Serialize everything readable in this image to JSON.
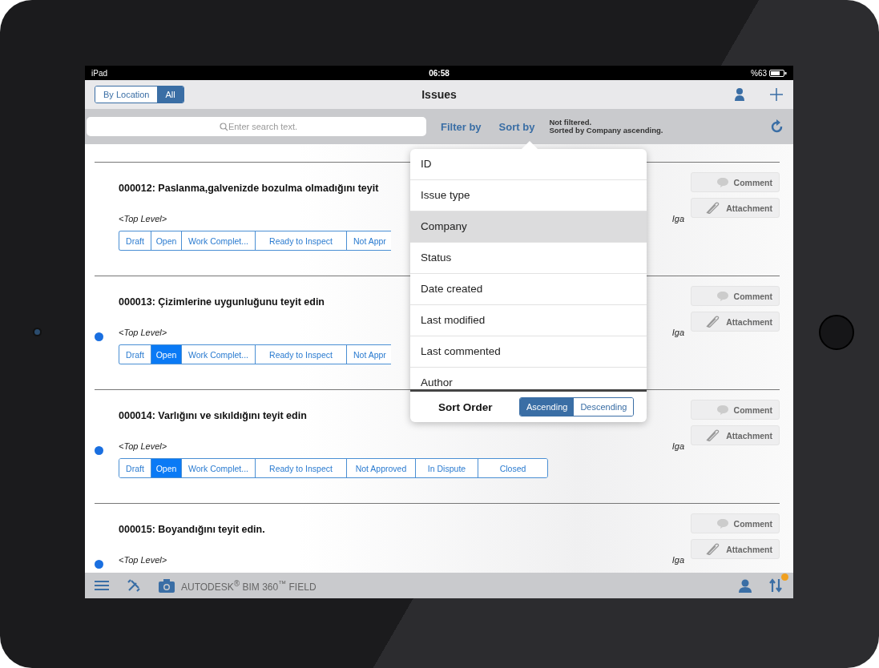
{
  "status_bar": {
    "device": "iPad",
    "time": "06:58",
    "battery": "%63"
  },
  "nav": {
    "segments": [
      {
        "label": "By Location",
        "selected": false
      },
      {
        "label": "All",
        "selected": true
      }
    ],
    "title": "Issues"
  },
  "search": {
    "placeholder": "Enter search text."
  },
  "filter_button": "Filter by",
  "sort_button": "Sort by",
  "filter_status": [
    "Not filtered.",
    "Sorted by Company ascending."
  ],
  "issues": [
    {
      "title": "000012: Paslanma,galvenizde bozulma olmadığını teyit",
      "unread": false,
      "location": "<Top Level>",
      "assignee": "Iga",
      "comment_button": "Comment",
      "attachment_button": "Attachment",
      "statuses": [
        {
          "label": "Draft",
          "selected": false
        },
        {
          "label": "Open",
          "selected": false
        },
        {
          "label": "Work Complet...",
          "selected": false
        },
        {
          "label": "Ready to Inspect",
          "selected": false
        },
        {
          "label": "Not Appr",
          "selected": false
        }
      ]
    },
    {
      "title": "000013: Çizimlerine uygunluğunu teyit edin",
      "unread": true,
      "location": "<Top Level>",
      "assignee": "Iga",
      "comment_button": "Comment",
      "attachment_button": "Attachment",
      "statuses": [
        {
          "label": "Draft",
          "selected": false
        },
        {
          "label": "Open",
          "selected": true
        },
        {
          "label": "Work Complet...",
          "selected": false
        },
        {
          "label": "Ready to Inspect",
          "selected": false
        },
        {
          "label": "Not Appr",
          "selected": false
        }
      ]
    },
    {
      "title": "000014: Varlığını ve sıkıldığını  teyit edin",
      "unread": true,
      "location": "<Top Level>",
      "assignee": "Iga",
      "comment_button": "Comment",
      "attachment_button": "Attachment",
      "statuses": [
        {
          "label": "Draft",
          "selected": false
        },
        {
          "label": "Open",
          "selected": true
        },
        {
          "label": "Work Complet...",
          "selected": false
        },
        {
          "label": "Ready to Inspect",
          "selected": false
        },
        {
          "label": "Not Approved",
          "selected": false
        },
        {
          "label": "In Dispute",
          "selected": false
        },
        {
          "label": "Closed",
          "selected": false
        }
      ]
    },
    {
      "title": "000015: Boyandığını teyit edin.",
      "unread": true,
      "location": "<Top Level>",
      "assignee": "Iga",
      "comment_button": "Comment",
      "attachment_button": "Attachment"
    }
  ],
  "sort_menu": {
    "options": [
      {
        "label": "ID",
        "selected": false
      },
      {
        "label": "Issue type",
        "selected": false
      },
      {
        "label": "Company",
        "selected": true
      },
      {
        "label": "Status",
        "selected": false
      },
      {
        "label": "Date created",
        "selected": false
      },
      {
        "label": "Last modified",
        "selected": false
      },
      {
        "label": "Last commented",
        "selected": false
      },
      {
        "label": "Author",
        "selected": false
      }
    ],
    "order_label": "Sort Order",
    "order": [
      {
        "label": "Ascending",
        "selected": true
      },
      {
        "label": "Descending",
        "selected": false
      }
    ]
  },
  "toolbar": {
    "brand": "AUTODESK$^{®}$ BIM 360$^{™}$ FIELD",
    "sync_badge": true
  }
}
